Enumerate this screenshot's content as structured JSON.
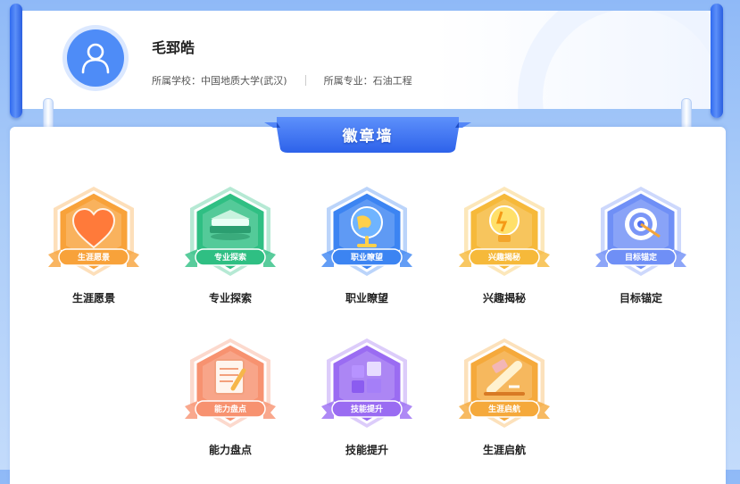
{
  "profile": {
    "name": "毛郅皓",
    "school_label": "所属学校：",
    "school": "中国地质大学(武汉)",
    "major_label": "所属专业：",
    "major": "石油工程",
    "avatar_icon": "user-icon"
  },
  "wall": {
    "title": "徽章墙"
  },
  "badges": [
    {
      "label": "生涯愿景",
      "tag": "生涯愿景",
      "icon": "heart-icon",
      "theme": "orange"
    },
    {
      "label": "专业探索",
      "tag": "专业探索",
      "icon": "book-icon",
      "theme": "green"
    },
    {
      "label": "职业瞭望",
      "tag": "职业瞭望",
      "icon": "globe-icon",
      "theme": "blue"
    },
    {
      "label": "兴趣揭秘",
      "tag": "兴趣揭秘",
      "icon": "lightbulb-icon",
      "theme": "yellow"
    },
    {
      "label": "目标锚定",
      "tag": "目标锚定",
      "icon": "target-icon",
      "theme": "periwinkle"
    },
    {
      "label": "能力盘点",
      "tag": "能力盘点",
      "icon": "notepad-icon",
      "theme": "salmon"
    },
    {
      "label": "技能提升",
      "tag": "技能提升",
      "icon": "blocks-icon",
      "theme": "purple"
    },
    {
      "label": "生涯启航",
      "tag": "生涯启航",
      "icon": "rocket-icon",
      "theme": "amber"
    }
  ],
  "colors": {
    "accent": "#3b74f2",
    "orange": "#f8a23a",
    "green": "#2fbf83",
    "blue": "#3c84f2",
    "yellow": "#f6b93a",
    "periwinkle": "#6f8ff6",
    "salmon": "#f79270",
    "purple": "#9a6cf2",
    "amber": "#f5a93b"
  }
}
